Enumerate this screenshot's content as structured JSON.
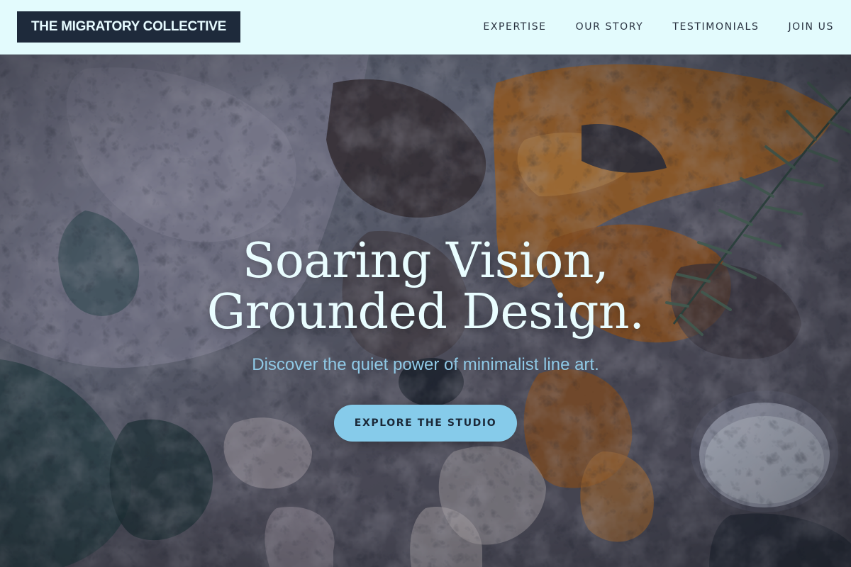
{
  "header": {
    "logo_text": "THE MIGRATORY COLLECTIVE",
    "nav": [
      {
        "label": "EXPERTISE"
      },
      {
        "label": "OUR STORY"
      },
      {
        "label": "TESTIMONIALS"
      },
      {
        "label": "JOIN US"
      }
    ]
  },
  "hero": {
    "headline_line1": "Soaring Vision,",
    "headline_line2": "Grounded Design.",
    "subheadline": "Discover the quiet power of minimalist line art.",
    "cta_label": "EXPLORE THE STUDIO",
    "background": "textured-oil-paint-palette-with-rosemary"
  },
  "colors": {
    "header_bg": "#e3fbfd",
    "logo_bg": "#1e2a3b",
    "headline": "#e9fdff",
    "subheadline": "#8fc9e6",
    "cta_bg": "#86cbea",
    "cta_text": "#1b2838"
  }
}
